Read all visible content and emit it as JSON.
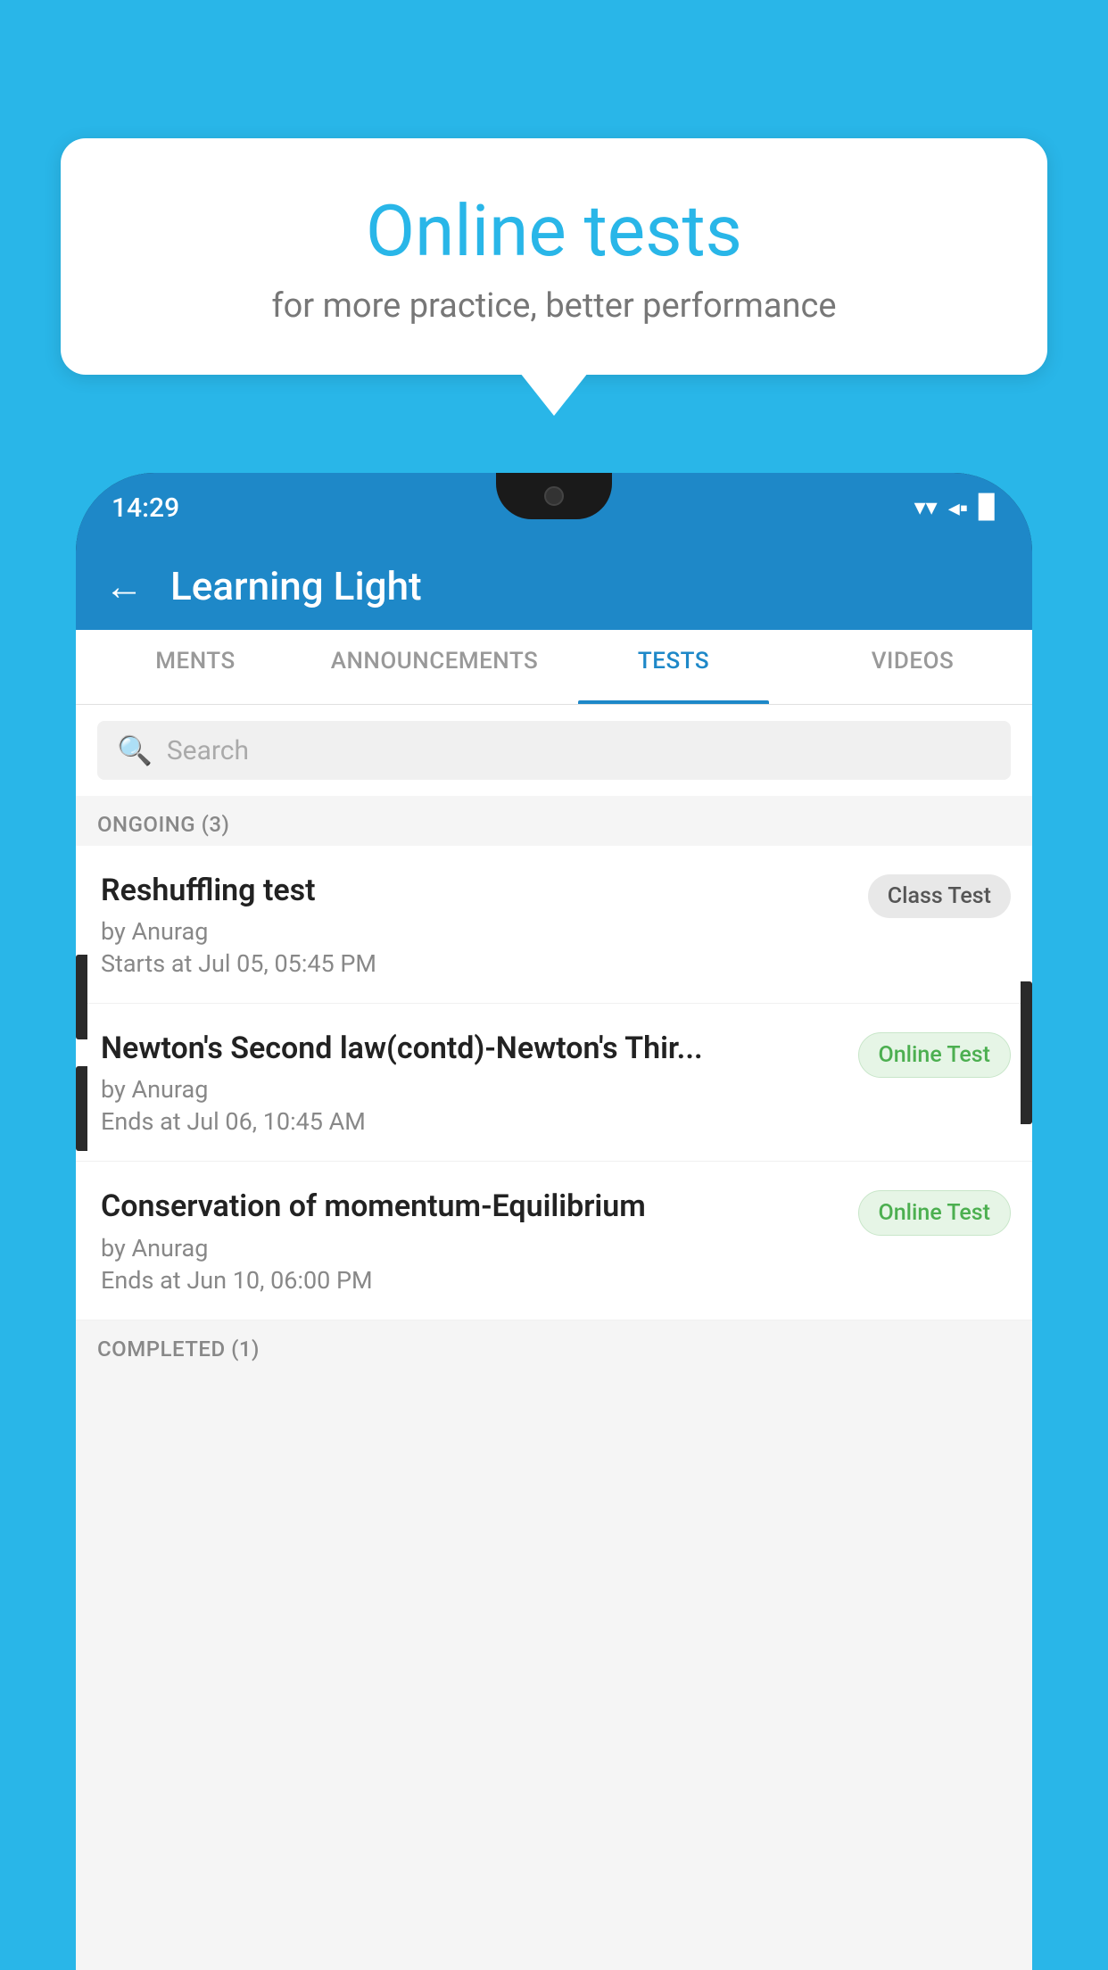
{
  "background_color": "#29b6e8",
  "speech_bubble": {
    "title": "Online tests",
    "subtitle": "for more practice, better performance"
  },
  "phone": {
    "status_bar": {
      "time": "14:29",
      "icons": [
        "▾▾",
        "◂◂",
        "▉"
      ]
    },
    "app_header": {
      "back_label": "←",
      "title": "Learning Light"
    },
    "tabs": [
      {
        "label": "MENTS",
        "active": false
      },
      {
        "label": "ANNOUNCEMENTS",
        "active": false
      },
      {
        "label": "TESTS",
        "active": true
      },
      {
        "label": "VIDEOS",
        "active": false
      }
    ],
    "search": {
      "placeholder": "Search"
    },
    "ongoing_section": {
      "header": "ONGOING (3)"
    },
    "tests": [
      {
        "name": "Reshuffling test",
        "author": "by Anurag",
        "date_label": "Starts at",
        "date": "Jul 05, 05:45 PM",
        "badge": "Class Test",
        "badge_type": "class"
      },
      {
        "name": "Newton's Second law(contd)-Newton's Thir...",
        "author": "by Anurag",
        "date_label": "Ends at",
        "date": "Jul 06, 10:45 AM",
        "badge": "Online Test",
        "badge_type": "online"
      },
      {
        "name": "Conservation of momentum-Equilibrium",
        "author": "by Anurag",
        "date_label": "Ends at",
        "date": "Jun 10, 06:00 PM",
        "badge": "Online Test",
        "badge_type": "online"
      }
    ],
    "completed_section": {
      "header": "COMPLETED (1)"
    }
  }
}
